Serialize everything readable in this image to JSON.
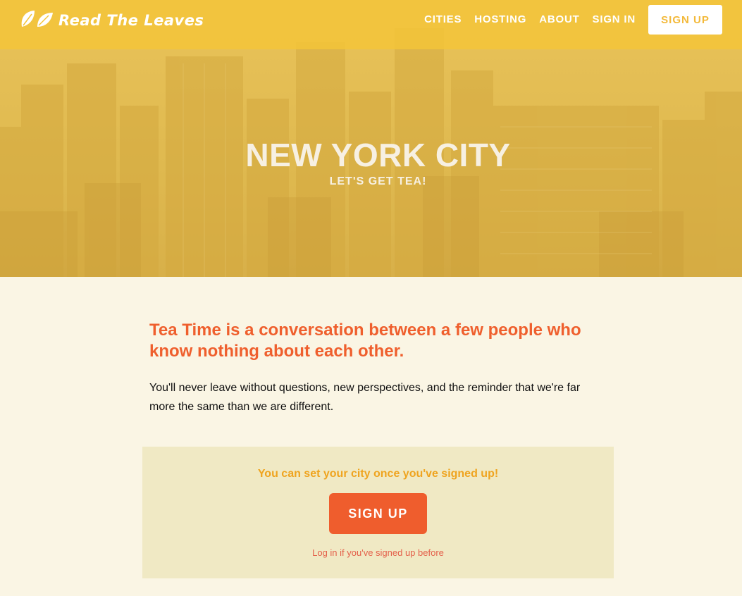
{
  "nav": {
    "logo_text": "Read The Leaves",
    "links": [
      "CITIES",
      "HOSTING",
      "ABOUT",
      "SIGN IN"
    ],
    "signup_label": "SIGN UP"
  },
  "hero": {
    "title": "NEW YORK CITY",
    "subtitle": "LET'S GET TEA!"
  },
  "intro": {
    "headline": "Tea Time is a conversation between a few people who know nothing about each other.",
    "body": "You'll never leave without questions, new perspectives, and the reminder that we're far more the same than we are different."
  },
  "cta": {
    "note": "You can set your city once you've signed up!",
    "signup_label": "SIGN UP",
    "login_link": "Log in if you've signed up before"
  },
  "colors": {
    "navbar": "#f4c438",
    "accent_orange": "#ef5d2d",
    "note_gold": "#efa41f",
    "page_bg": "#faf5e4",
    "cta_bg": "#f0e9c4"
  },
  "icons": [
    "leaves-logo-icon"
  ]
}
